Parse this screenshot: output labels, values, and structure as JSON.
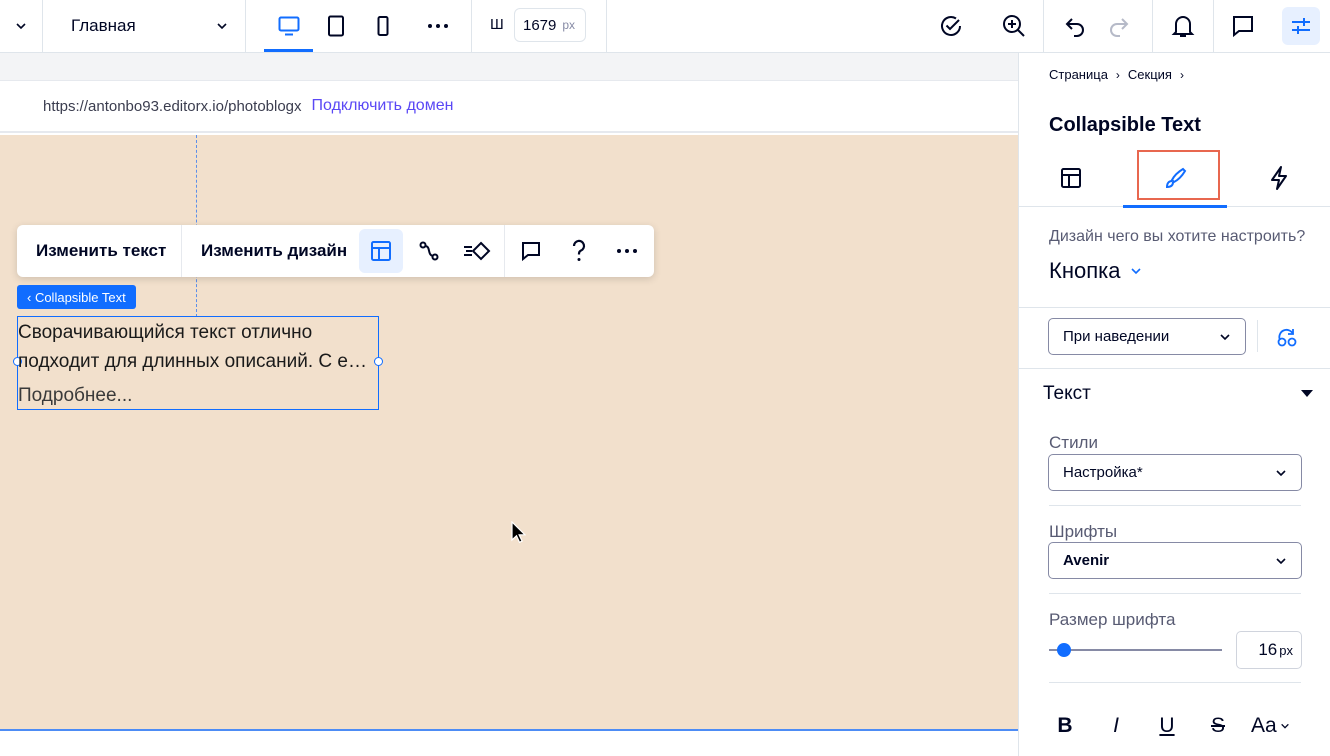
{
  "topbar": {
    "page_name": "Главная",
    "width_label": "Ш",
    "width_value": "1679",
    "width_unit": "px"
  },
  "canvas": {
    "site_url": "https://antonbo93.editorx.io/photoblogx",
    "connect_domain": "Подключить домен",
    "toolbar": {
      "edit_text": "Изменить текст",
      "edit_design": "Изменить дизайн"
    },
    "selection_tag": "‹ Collapsible Text",
    "element": {
      "body_line1": "Сворачивающийся текст отлично",
      "body_line2": "подходит для длинных описаний. С е…",
      "read_more": "Подробнее..."
    }
  },
  "panel": {
    "breadcrumb": [
      "Страница",
      "Секция"
    ],
    "title": "Collapsible Text",
    "active_tab": "design",
    "question": "Дизайн чего вы хотите настроить?",
    "target": "Кнопка",
    "state": "При наведении",
    "section_title": "Текст",
    "styles_label": "Стили",
    "styles_value": "Настройка*",
    "fonts_label": "Шрифты",
    "fonts_value": "Avenir",
    "size_label": "Размер шрифта",
    "size_value": "16",
    "size_unit": "px",
    "format": {
      "bold": "B",
      "italic": "I",
      "underline": "U",
      "strike": "S",
      "case": "Aa"
    }
  },
  "colors": {
    "accent": "#116dff",
    "canvas_bg": "#f2e0cc",
    "link": "#5a48f5",
    "highlight_outline": "#e8674f"
  }
}
